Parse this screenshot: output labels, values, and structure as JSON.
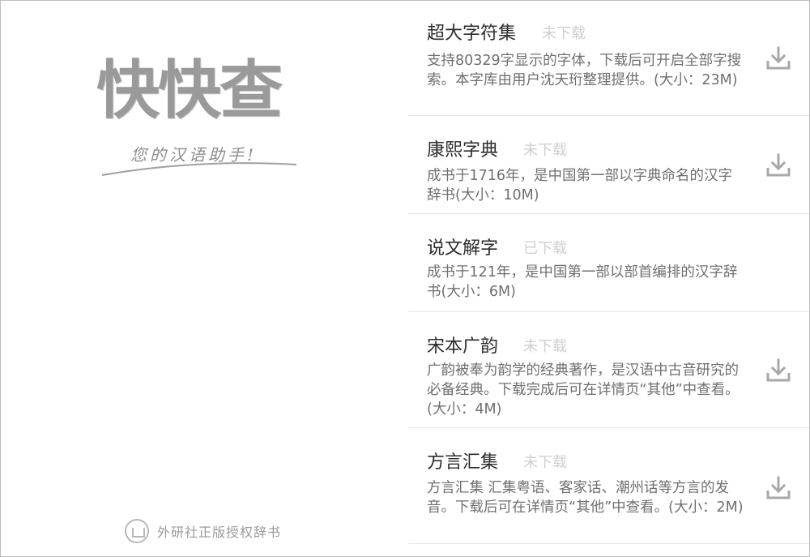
{
  "splash": {
    "logo_title": "快快查",
    "slogan": "您的汉语助手!",
    "publisher": "外研社正版授权辞书"
  },
  "dictionaries": [
    {
      "name": "超大字符集",
      "status": "未下载",
      "description": "支持80329字显示的字体，下载后可开启全部字搜索。本字库由用户沈天珩整理提供。(大小：23M)",
      "downloadable": true,
      "icon": "download-icon"
    },
    {
      "name": "康熙字典",
      "status": "未下载",
      "description": "成书于1716年，是中国第一部以字典命名的汉字辞书(大小：10M)",
      "downloadable": true,
      "icon": "download-icon"
    },
    {
      "name": "说文解字",
      "status": "已下载",
      "description": "成书于121年，是中国第一部以部首编排的汉字辞书(大小：6M)",
      "downloadable": false,
      "icon": ""
    },
    {
      "name": "宋本广韵",
      "status": "未下载",
      "description": "广韵被奉为韵学的经典著作，是汉语中古音研究的必备经典。下载完成后可在详情页“其他”中查看。(大小：4M)",
      "downloadable": true,
      "icon": "download-icon"
    },
    {
      "name": "方言汇集",
      "status": "未下载",
      "description": "方言汇集 汇集粤语、客家话、潮州话等方言的发音。下载后可在详情页“其他”中查看。(大小：2M)",
      "downloadable": true,
      "icon": "download-icon"
    }
  ],
  "colors": {
    "title_text": "#2c2c2c",
    "status_text": "#cfcfcf",
    "description_text": "#6f6f6f",
    "icon_gray": "#a8a8a8",
    "divider": "#e6e6e6"
  }
}
